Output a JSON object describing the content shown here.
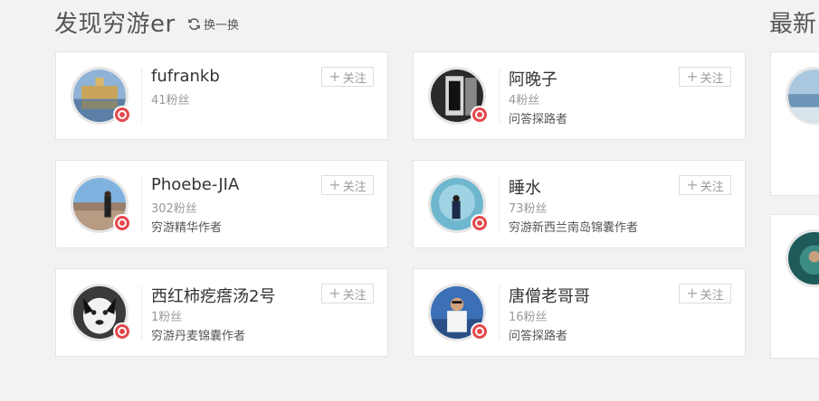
{
  "section": {
    "title": "发现穷游er",
    "refresh_label": "换一换",
    "right_title_partial": "最新"
  },
  "follow_label": "关注",
  "users": [
    {
      "name": "fufrankb",
      "fans": "41粉丝",
      "desc": "",
      "avatar": "temple-reflection-photo"
    },
    {
      "name": "阿晚子",
      "fans": "4粉丝",
      "desc": "问答探路者",
      "avatar": "bw-doorway-photo"
    },
    {
      "name": "Phoebe-JIA",
      "fans": "302粉丝",
      "desc": "穷游精华作者",
      "avatar": "city-view-photo"
    },
    {
      "name": "睡水",
      "fans": "73粉丝",
      "desc": "穷游新西兰南岛锦囊作者",
      "avatar": "ice-cave-photo"
    },
    {
      "name": "西红柿疙瘩汤2号",
      "fans": "1粉丝",
      "desc": "穷游丹麦锦囊作者",
      "avatar": "husky-dog-photo"
    },
    {
      "name": "唐僧老哥哥",
      "fans": "16粉丝",
      "desc": "问答探路者",
      "avatar": "traveler-portrait-photo"
    }
  ]
}
